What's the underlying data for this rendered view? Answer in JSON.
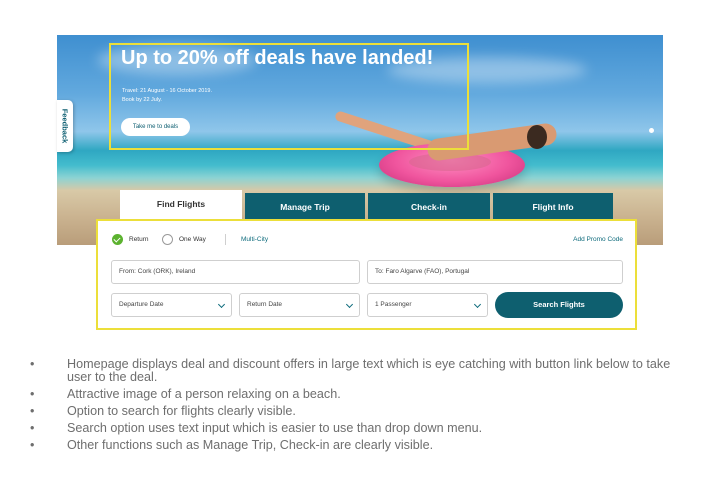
{
  "hero": {
    "headline": "Up to 20% off deals have landed!",
    "travel_dates": "Travel: 21 August - 16 October 2019.",
    "book_by": "Book by 22 July.",
    "cta_label": "Take me to deals",
    "feedback_label": "Feedback"
  },
  "tabs": [
    {
      "label": "Find Flights",
      "active": true
    },
    {
      "label": "Manage Trip",
      "active": false
    },
    {
      "label": "Check-in",
      "active": false
    },
    {
      "label": "Flight Info",
      "active": false
    }
  ],
  "search": {
    "trip_types": [
      {
        "label": "Return",
        "selected": true
      },
      {
        "label": "One Way",
        "selected": false
      },
      {
        "label": "Multi-City",
        "selected": false
      }
    ],
    "promo_label": "Add Promo Code",
    "from_value": "From: Cork (ORK), Ireland",
    "to_value": "To: Faro Algarve (FAO), Portugal",
    "departure_placeholder": "Departure Date",
    "return_placeholder": "Return Date",
    "passengers_value": "1 Passenger",
    "submit_label": "Search Flights"
  },
  "colors": {
    "brand_teal": "#0e5f6f",
    "highlight_yellow": "#ecdf3a",
    "selected_green": "#5cb22f"
  },
  "notes": [
    "Homepage displays deal and discount offers in large text which is eye catching with button link below to take user to the deal.",
    "Attractive image of a person relaxing on a beach.",
    "Option to search for flights clearly visible.",
    "Search option uses text input which is easier to use than drop down menu.",
    "Other functions such as Manage Trip, Check-in are clearly visible."
  ]
}
